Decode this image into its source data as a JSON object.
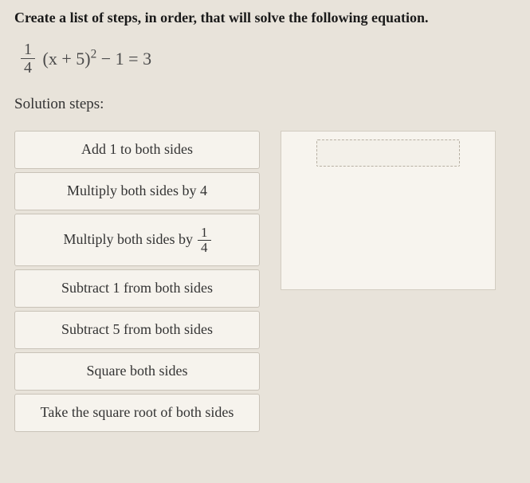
{
  "prompt": "Create a list of steps, in order, that will solve the following equation.",
  "equation": {
    "frac_num": "1",
    "frac_den": "4",
    "body": "(x + 5)",
    "exp": "2",
    "tail": " − 1 = 3"
  },
  "subheading": "Solution steps:",
  "steps": [
    {
      "label": "Add 1 to both sides",
      "has_frac": false
    },
    {
      "label": "Multiply both sides by 4",
      "has_frac": false
    },
    {
      "label_pre": "Multiply both sides by ",
      "has_frac": true,
      "frac_num": "1",
      "frac_den": "4"
    },
    {
      "label": "Subtract 1 from both sides",
      "has_frac": false
    },
    {
      "label": "Subtract 5 from both sides",
      "has_frac": false
    },
    {
      "label": "Square both sides",
      "has_frac": false
    },
    {
      "label": "Take the square root of both sides",
      "has_frac": false
    }
  ]
}
